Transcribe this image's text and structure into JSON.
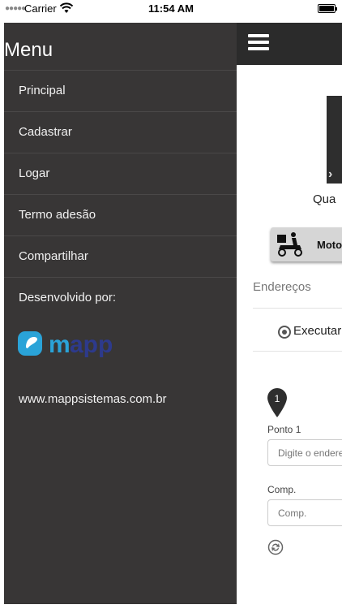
{
  "status_bar": {
    "carrier": "Carrier",
    "time": "11:54 AM"
  },
  "menu": {
    "title": "Menu",
    "items": [
      {
        "label": "Principal"
      },
      {
        "label": "Cadastrar"
      },
      {
        "label": "Logar"
      },
      {
        "label": "Termo adesão"
      },
      {
        "label": "Compartilhar"
      }
    ],
    "developed_by": "Desenvolvido por:",
    "logo_text": "mapp",
    "website": "www.mappsistemas.com.br"
  },
  "app": {
    "partial_label": "Qua",
    "moto_button": "Moto",
    "section_title": "Endereços",
    "radio_label": "Executar",
    "point_number": "1",
    "point_label": "Ponto 1",
    "address_placeholder": "Digite o endereço",
    "comp_label": "Comp.",
    "comp_placeholder": "Comp."
  },
  "colors": {
    "menu_bg": "#383636",
    "header_bg": "#2b2b2b",
    "logo_accent": "#2aa3d8",
    "logo_dark": "#2d3a8c"
  }
}
